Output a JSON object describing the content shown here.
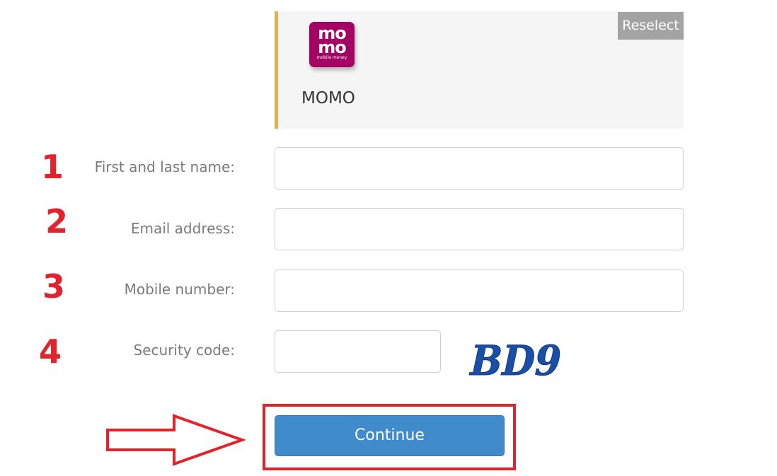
{
  "payment_method": {
    "logo": {
      "line1": "mo",
      "line2": "mo",
      "subtitle": "mobile money",
      "color": "#a50064"
    },
    "name": "MOMO",
    "reselect_label": "Reselect",
    "accent_color": "#e8b04a"
  },
  "form": {
    "fields": [
      {
        "step": "1",
        "label": "First and last name:",
        "value": ""
      },
      {
        "step": "2",
        "label": "Email address:",
        "value": ""
      },
      {
        "step": "3",
        "label": "Mobile number:",
        "value": ""
      },
      {
        "step": "4",
        "label": "Security code:",
        "value": ""
      }
    ],
    "captcha_text": "BD9",
    "continue_label": "Continue"
  },
  "annotations": {
    "highlight_color": "#e3232b",
    "arrow_icon": "right-arrow-outline-icon"
  },
  "colors": {
    "button": "#3f8bcb",
    "captcha": "#1a4fa8"
  }
}
